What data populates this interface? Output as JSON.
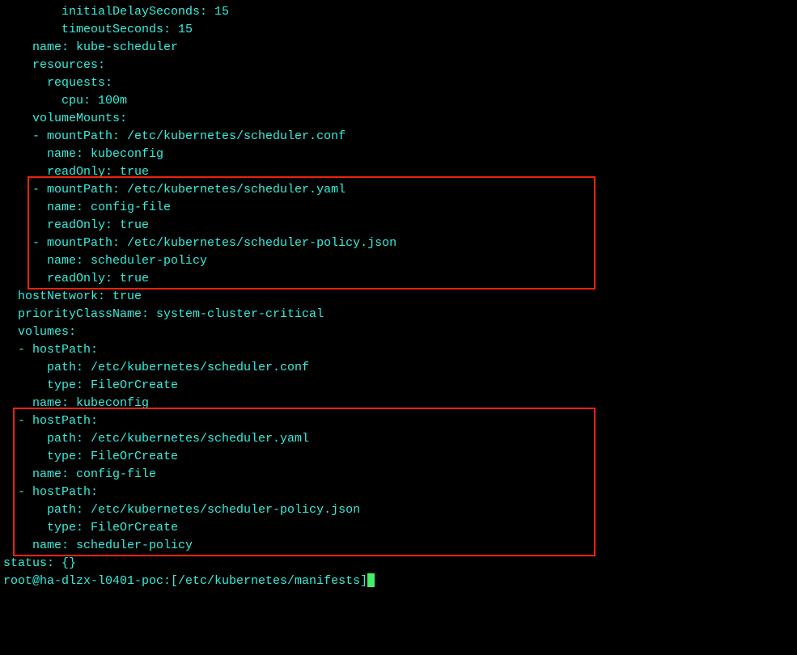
{
  "lines": {
    "l0": "        initialDelaySeconds: 15",
    "l1": "        timeoutSeconds: 15",
    "l2": "    name: kube-scheduler",
    "l3": "    resources:",
    "l4": "      requests:",
    "l5": "        cpu: 100m",
    "l6": "    volumeMounts:",
    "l7": "    - mountPath: /etc/kubernetes/scheduler.conf",
    "l8": "      name: kubeconfig",
    "l9": "      readOnly: true",
    "l10": "    - mountPath: /etc/kubernetes/scheduler.yaml",
    "l11": "      name: config-file",
    "l12": "      readOnly: true",
    "l13": "    - mountPath: /etc/kubernetes/scheduler-policy.json",
    "l14": "      name: scheduler-policy",
    "l15": "      readOnly: true",
    "l16": "  hostNetwork: true",
    "l17": "  priorityClassName: system-cluster-critical",
    "l18": "  volumes:",
    "l19": "  - hostPath:",
    "l20": "      path: /etc/kubernetes/scheduler.conf",
    "l21": "      type: FileOrCreate",
    "l22": "    name: kubeconfig",
    "l23": "  - hostPath:",
    "l24": "      path: /etc/kubernetes/scheduler.yaml",
    "l25": "      type: FileOrCreate",
    "l26": "    name: config-file",
    "l27": "  - hostPath:",
    "l28": "      path: /etc/kubernetes/scheduler-policy.json",
    "l29": "      type: FileOrCreate",
    "l30": "    name: scheduler-policy",
    "l31": "status: {}"
  },
  "prompt": "root@ha-dlzx-l0401-poc:[/etc/kubernetes/manifests]"
}
